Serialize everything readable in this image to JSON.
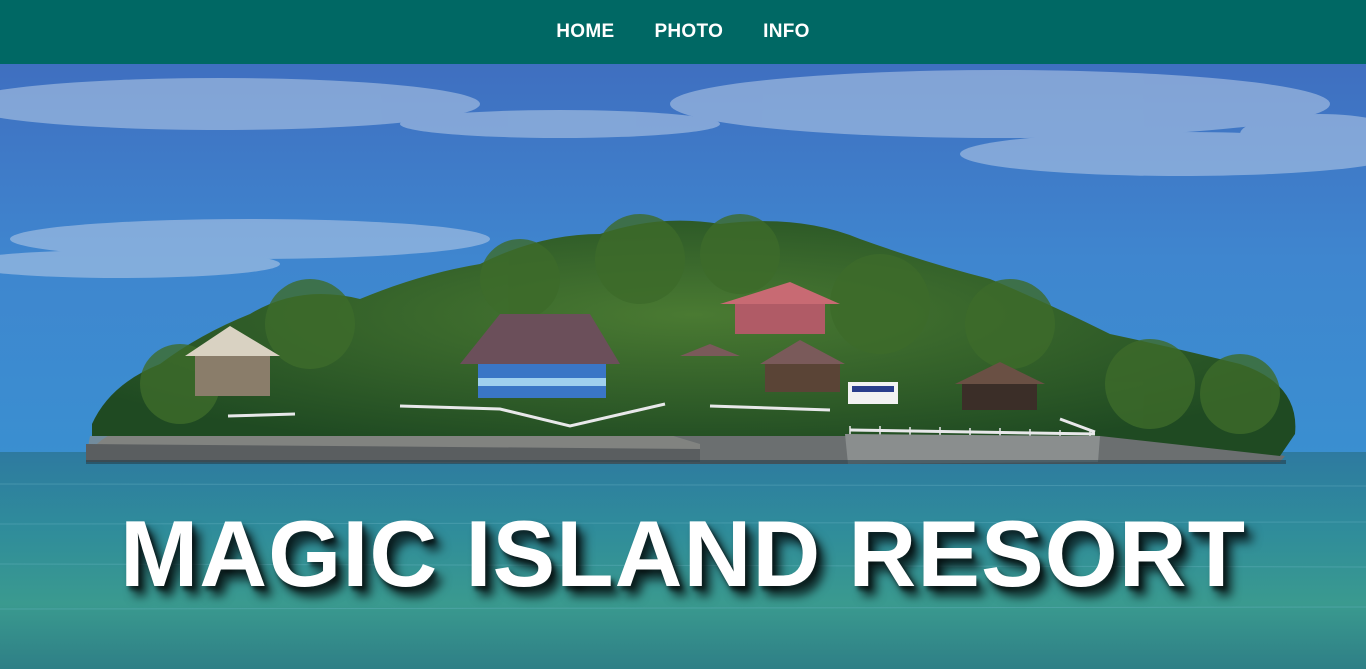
{
  "nav": {
    "items": [
      {
        "label": "HOME"
      },
      {
        "label": "PHOTO"
      },
      {
        "label": "INFO"
      }
    ]
  },
  "hero": {
    "title": "MAGIC ISLAND RESORT",
    "image_description_icon": "island-photo"
  },
  "colors": {
    "nav_background": "#006864",
    "nav_text": "#ffffff",
    "title_text": "#ffffff"
  }
}
